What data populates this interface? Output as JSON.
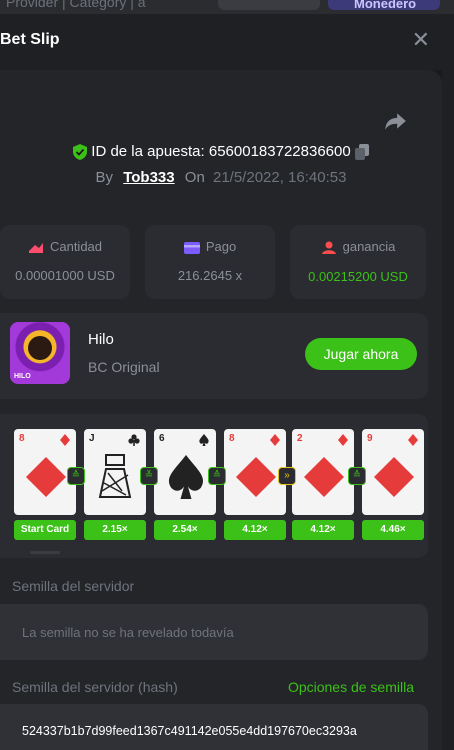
{
  "background": {
    "strip_text": "Provider | Category | a",
    "wallet_button": "Monedero"
  },
  "header": {
    "title": "Bet Slip",
    "close_symbol": "✕"
  },
  "bet": {
    "id_label": "ID de la apuesta:",
    "id_value": "65600183722836600",
    "by_label": "By",
    "user": "Tob333",
    "on_label": "On",
    "date": "21/5/2022, 16:40:53"
  },
  "stats": [
    {
      "label": "Cantidad",
      "value": "0.00001000 USD",
      "icon": "amount-icon",
      "color": "#ff4d6d"
    },
    {
      "label": "Pago",
      "value": "216.2645 x",
      "icon": "payout-icon",
      "color": "#7d5cff"
    },
    {
      "label": "ganancia",
      "value": "0.00215200 USD",
      "icon": "profit-icon",
      "color": "#ff4d4d"
    }
  ],
  "game": {
    "name": "Hilo",
    "provider": "BC Original",
    "play_label": "Jugar ahora",
    "thumb_text": "HILO"
  },
  "cards": [
    {
      "rank": "8",
      "suit": "diamond",
      "color": "red"
    },
    {
      "rank": "J",
      "suit": "club",
      "color": "black"
    },
    {
      "rank": "6",
      "suit": "spade",
      "color": "black"
    },
    {
      "rank": "8",
      "suit": "diamond",
      "color": "red"
    },
    {
      "rank": "2",
      "suit": "diamond",
      "color": "red"
    },
    {
      "rank": "9",
      "suit": "diamond",
      "color": "red"
    }
  ],
  "arrows": [
    {
      "symbol": "≙",
      "kind": "higher-or-same"
    },
    {
      "symbol": "≚",
      "kind": "lower-or-same"
    },
    {
      "symbol": "≙",
      "kind": "higher-or-same"
    },
    {
      "symbol": "»",
      "kind": "skip"
    },
    {
      "symbol": "≙",
      "kind": "higher-or-same"
    }
  ],
  "multipliers": [
    "Start Card",
    "2.15×",
    "2.54×",
    "4.12×",
    "4.12×",
    "4.46×"
  ],
  "seeds": {
    "server_seed_label": "Semilla del servidor",
    "server_seed_value": "La semilla no se ha revelado todavía",
    "server_hash_label": "Semilla del servidor (hash)",
    "seed_options_link": "Opciones de semilla",
    "server_hash_value": "524337b1b7d99feed1367c491142e055e4dd197670ec3293a"
  },
  "colors": {
    "accent_green": "#3bc117",
    "panel": "#232529",
    "card_bg": "#2a2c31"
  }
}
